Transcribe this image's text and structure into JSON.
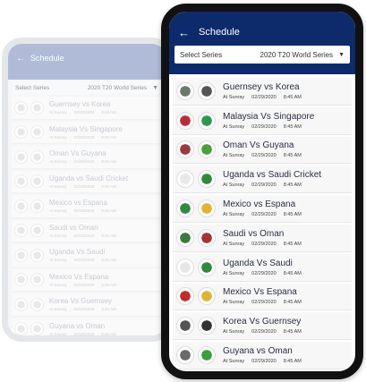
{
  "screen": {
    "title": "Schedule",
    "back_icon": "arrow-left-icon",
    "select_label": "Select Series",
    "select_value": "2020 T20 World Series",
    "dropdown_icon": "caret-down-icon"
  },
  "colors": {
    "appbar": "#0d2a6b",
    "phone_frame": "#111111"
  },
  "front_matches": [
    {
      "match": "Guernsey vs Korea",
      "venue": "At Sunray",
      "date": "02/29/2020",
      "time": "8:45 AM",
      "logo_a": "#6a7a6a",
      "logo_b": "#555555"
    },
    {
      "match": "Malaysia Vs Singapore",
      "venue": "At Sunray",
      "date": "02/29/2020",
      "time": "8:45 AM",
      "logo_a": "#c0283a",
      "logo_b": "#2a9a4a"
    },
    {
      "match": "Oman Vs Guyana",
      "venue": "At Sunray",
      "date": "02/29/2020",
      "time": "8:45 AM",
      "logo_a": "#9a3a3a",
      "logo_b": "#4aa03a"
    },
    {
      "match": "Uganda vs Saudi Cricket",
      "venue": "At Sunray",
      "date": "02/29/2020",
      "time": "8:45 AM",
      "logo_a": "#e8e8e8",
      "logo_b": "#2f8a3a"
    },
    {
      "match": "Mexico vs Espana",
      "venue": "At Sunray",
      "date": "02/29/2020",
      "time": "8:45 AM",
      "logo_a": "#2e8a3e",
      "logo_b": "#e2b230"
    },
    {
      "match": "Saudi vs Oman",
      "venue": "At Sunray",
      "date": "02/29/2020",
      "time": "8:45 AM",
      "logo_a": "#3a7a3a",
      "logo_b": "#a83232"
    },
    {
      "match": "Uganda Vs Saudi",
      "venue": "At Sunray",
      "date": "02/29/2020",
      "time": "8:45 AM",
      "logo_a": "#e6e6e6",
      "logo_b": "#2f8a3a"
    },
    {
      "match": "Mexico Vs Espana",
      "venue": "At Sunray",
      "date": "02/29/2020",
      "time": "8:45 AM",
      "logo_a": "#c42b2b",
      "logo_b": "#e2b230"
    },
    {
      "match": "Korea Vs Guernsey",
      "venue": "At Sunray",
      "date": "02/29/2020",
      "time": "8:45 AM",
      "logo_a": "#555555",
      "logo_b": "#333333"
    },
    {
      "match": "Guyana vs Oman",
      "venue": "At Sunray",
      "date": "02/29/2020",
      "time": "8:45 AM",
      "logo_a": "#6a6a6a",
      "logo_b": "#3aa03a"
    }
  ],
  "back_matches": [
    {
      "match": "Guernsey vs Korea",
      "venue": "At Sunray",
      "date": "02/29/2020",
      "time": "8:45 AM"
    },
    {
      "match": "Malaysia Vs Singapore",
      "venue": "At Sunray",
      "date": "02/29/2020",
      "time": "8:45 AM"
    },
    {
      "match": "Oman Vs Guyana",
      "venue": "At Sunray",
      "date": "02/29/2020",
      "time": "8:45 AM"
    },
    {
      "match": "Uganda vs Saudi Cricket",
      "venue": "At Sunray",
      "date": "02/29/2020",
      "time": "8:45 AM"
    },
    {
      "match": "Mexico vs Espana",
      "venue": "At Sunray",
      "date": "02/29/2020",
      "time": "8:45 AM"
    },
    {
      "match": "Saudi vs Oman",
      "venue": "At Sunray",
      "date": "02/29/2020",
      "time": "8:45 AM"
    },
    {
      "match": "Uganda Vs Saudi",
      "venue": "At Sunray",
      "date": "02/29/2020",
      "time": "8:45 AM"
    },
    {
      "match": "Mexico Vs Espana",
      "venue": "At Sunray",
      "date": "02/29/2020",
      "time": "8:45 AM"
    },
    {
      "match": "Korea Vs Guernsey",
      "venue": "At Sunray",
      "date": "02/29/2020",
      "time": "8:45 AM"
    },
    {
      "match": "Guyana vs Oman",
      "venue": "At Sunray",
      "date": "02/29/2020",
      "time": "8:45 AM"
    }
  ]
}
